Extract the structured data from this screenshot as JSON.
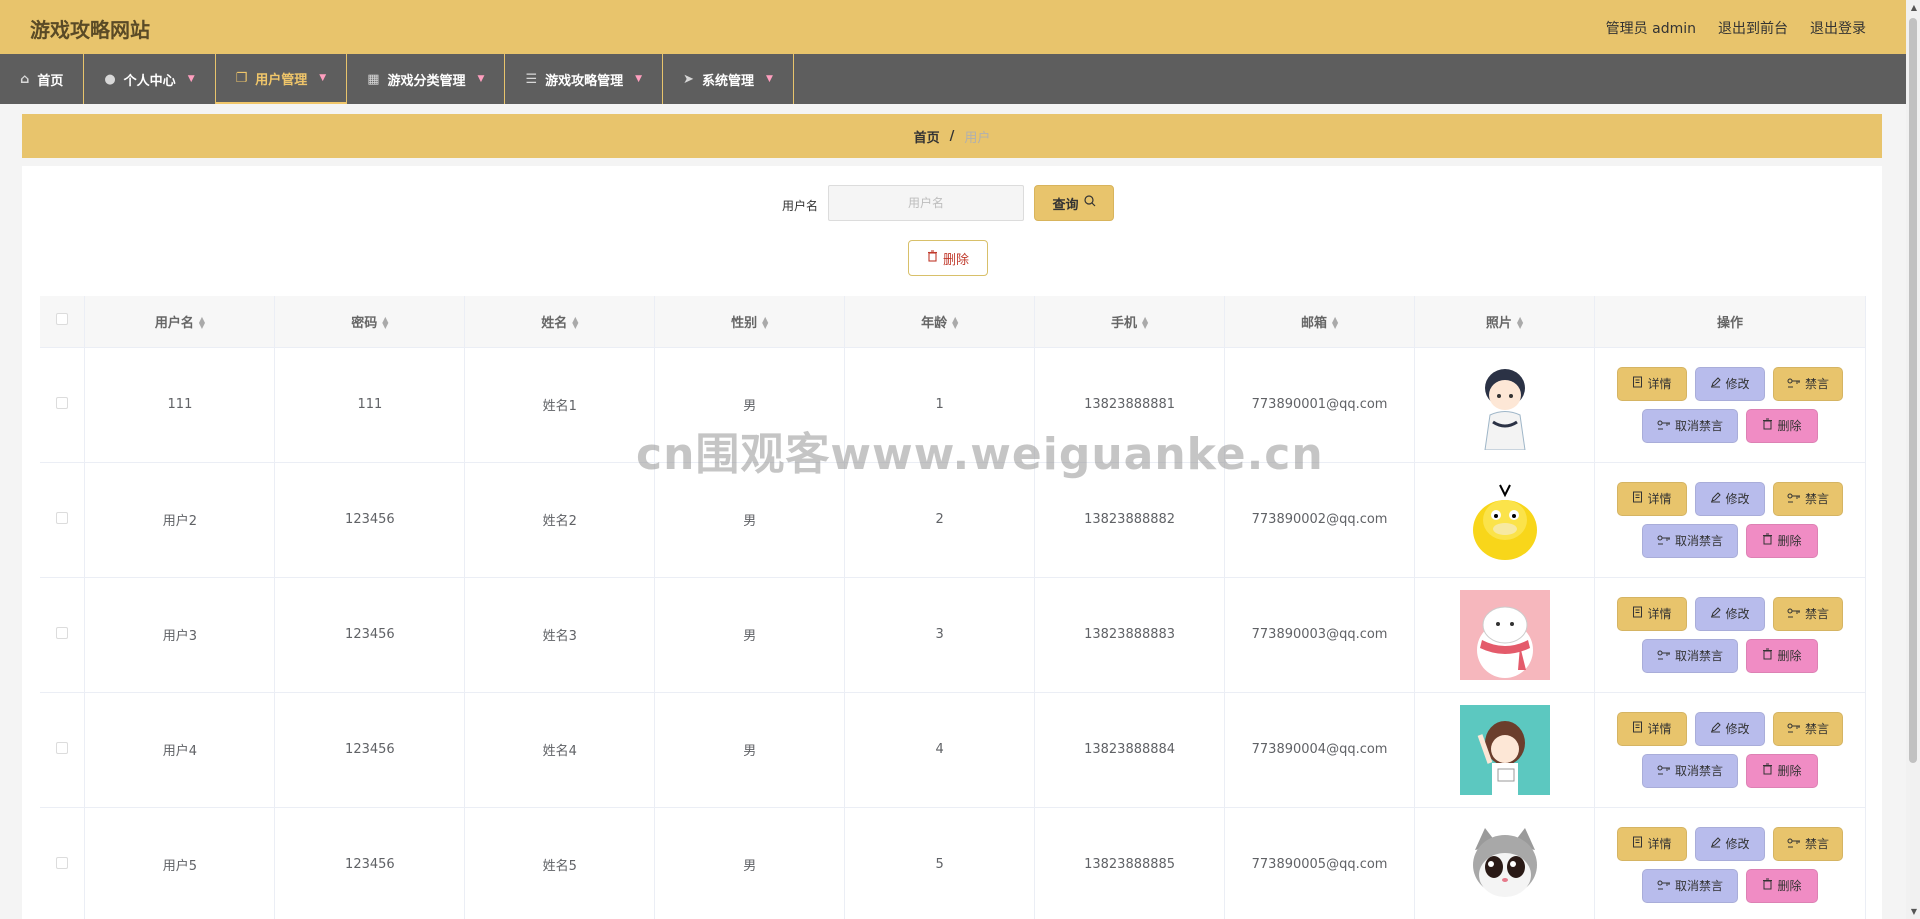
{
  "header": {
    "site_title": "游戏攻略网站",
    "admin_label": "管理员 admin",
    "to_front_label": "退出到前台",
    "logout_label": "退出登录"
  },
  "nav": {
    "items": [
      {
        "label": "首页",
        "icon": "home-icon"
      },
      {
        "label": "个人中心",
        "icon": "user-icon"
      },
      {
        "label": "用户管理",
        "icon": "copy-icon"
      },
      {
        "label": "游戏分类管理",
        "icon": "grid-icon"
      },
      {
        "label": "游戏攻略管理",
        "icon": "list-icon"
      },
      {
        "label": "系统管理",
        "icon": "send-icon"
      }
    ],
    "active_index": 2
  },
  "breadcrumb": {
    "home": "首页",
    "separator": "/",
    "current": "用户"
  },
  "search": {
    "label": "用户名",
    "placeholder": "用户名",
    "query_label": "查询",
    "delete_label": "删除"
  },
  "table": {
    "columns": [
      "用户名",
      "密码",
      "姓名",
      "性别",
      "年龄",
      "手机",
      "邮箱",
      "照片",
      "操作"
    ],
    "rows": [
      {
        "username": "111",
        "password": "111",
        "name": "姓名1",
        "gender": "男",
        "age": "1",
        "phone": "13823888881",
        "email": "773890001@qq.com",
        "photo": "boy-avatar"
      },
      {
        "username": "用户2",
        "password": "123456",
        "name": "姓名2",
        "gender": "男",
        "age": "2",
        "phone": "13823888882",
        "email": "773890002@qq.com",
        "photo": "duck-avatar"
      },
      {
        "username": "用户3",
        "password": "123456",
        "name": "姓名3",
        "gender": "男",
        "age": "3",
        "phone": "13823888883",
        "email": "773890003@qq.com",
        "photo": "cat-scarf-avatar"
      },
      {
        "username": "用户4",
        "password": "123456",
        "name": "姓名4",
        "gender": "男",
        "age": "4",
        "phone": "13823888884",
        "email": "773890004@qq.com",
        "photo": "girl-avatar"
      },
      {
        "username": "用户5",
        "password": "123456",
        "name": "姓名5",
        "gender": "男",
        "age": "5",
        "phone": "13823888885",
        "email": "773890005@qq.com",
        "photo": "kitten-avatar"
      }
    ],
    "actions": {
      "detail": "详情",
      "edit": "修改",
      "ban": "禁言",
      "unban": "取消禁言",
      "delete": "删除"
    }
  },
  "watermark": "cn围观客www.weiguanke.cn",
  "colors": {
    "accent": "#e8c46c",
    "nav_bg": "#5e5e5e",
    "edit_button": "#b8bcec",
    "delete_button": "#f08cc4"
  }
}
